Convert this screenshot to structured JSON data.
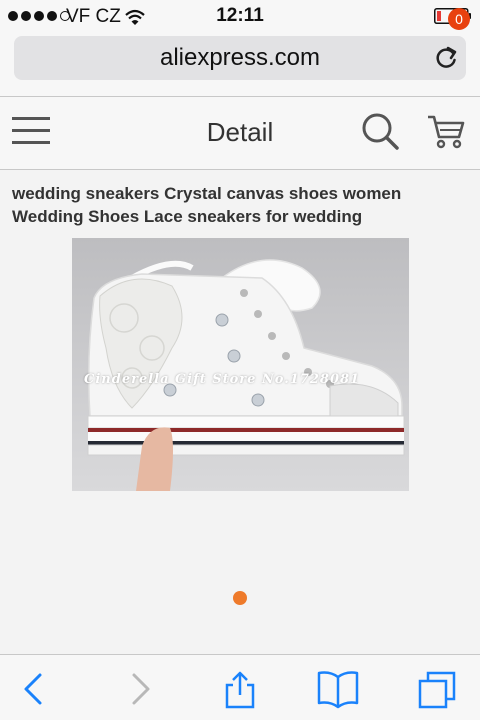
{
  "status_bar": {
    "carrier": "VF CZ",
    "time": "12:11",
    "signal_bars_filled": 4,
    "signal_bars_total": 5,
    "battery_level": 0.1,
    "battery_color": "#e53935"
  },
  "browser": {
    "url": "aliexpress.com",
    "reload_icon": "reload-icon"
  },
  "header": {
    "menu_icon": "menu-icon",
    "title": "Detail",
    "search_icon": "search-icon",
    "cart_icon": "cart-icon",
    "cart_count": "0",
    "badge_color": "#e8410f"
  },
  "product": {
    "title": "wedding sneakers Crystal canvas shoes women Wedding Shoes Lace sneakers for wedding",
    "image_watermark": "Cinderella Gift Store No.1728081",
    "carousel_active_index": 0,
    "carousel_count": 1,
    "dot_color": "#ee7a2a"
  },
  "toolbar": {
    "back_icon": "back-icon",
    "forward_icon": "forward-icon",
    "share_icon": "share-icon",
    "bookmarks_icon": "bookmarks-icon",
    "tabs_icon": "tabs-icon",
    "accent_color": "#1a82fb"
  }
}
